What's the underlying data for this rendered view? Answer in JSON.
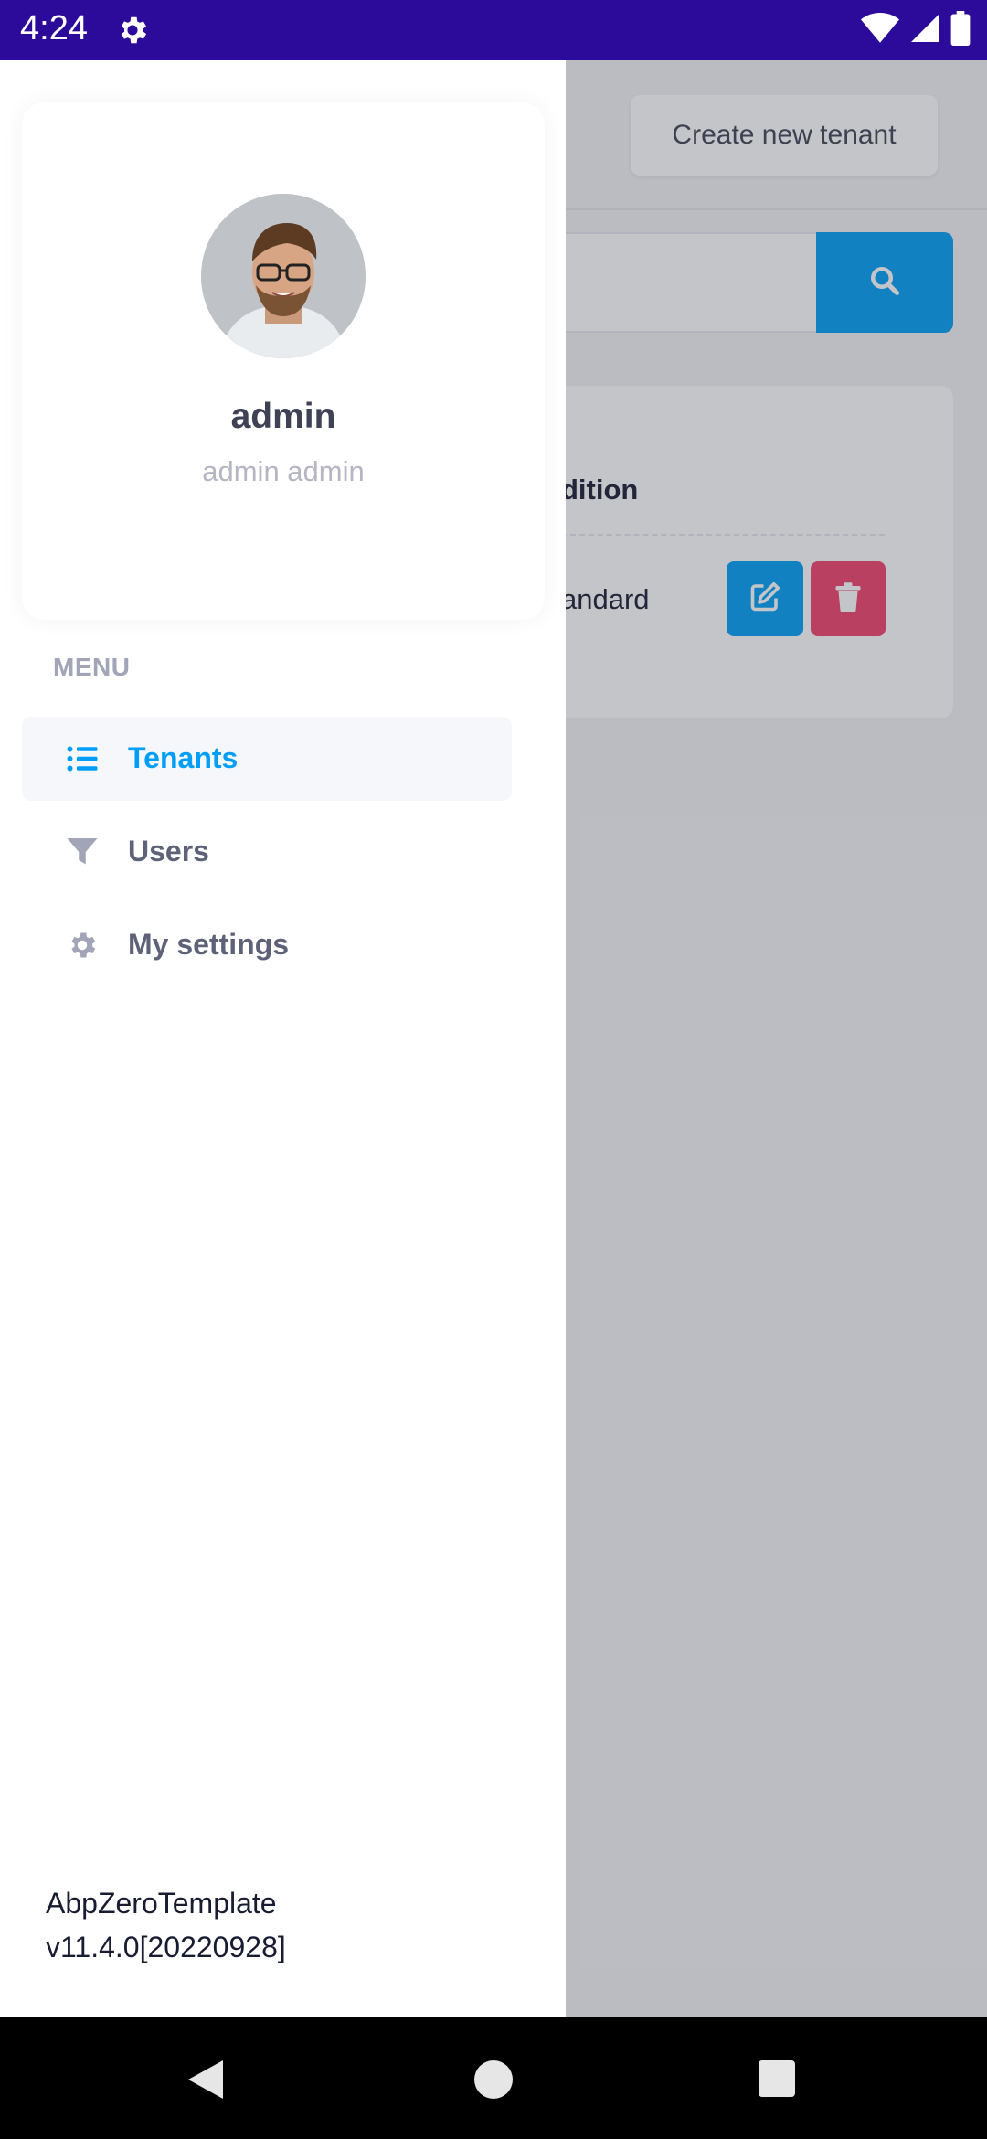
{
  "status_bar": {
    "time": "4:24",
    "background": "#2c0b9a"
  },
  "background_page": {
    "create_button_label": "Create new tenant",
    "search": {
      "placeholder": ""
    },
    "table": {
      "header_partial": "dition",
      "row": {
        "edition_partial": "andard"
      }
    }
  },
  "drawer": {
    "profile": {
      "name": "admin",
      "subtitle": "admin admin"
    },
    "menu_label": "MENU",
    "items": [
      {
        "label": "Tenants",
        "icon": "list-icon",
        "active": true
      },
      {
        "label": "Users",
        "icon": "filter-icon",
        "active": false
      },
      {
        "label": "My settings",
        "icon": "gear-icon",
        "active": false
      }
    ],
    "version_line1": "AbpZeroTemplate",
    "version_line2": "v11.4.0[20220928]"
  },
  "colors": {
    "accent": "#009ef7",
    "danger": "#f1416c",
    "active_menu_bg": "#f5f7fb",
    "menu_text": "#5e6278"
  }
}
